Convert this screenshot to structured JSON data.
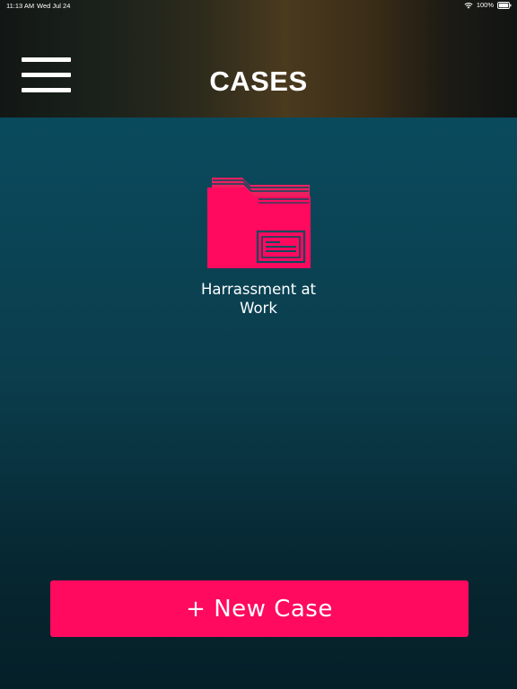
{
  "status_bar": {
    "time": "11:13 AM",
    "date": "Wed Jul 24",
    "battery": "100%",
    "wifi_icon": "wifi-icon",
    "battery_icon": "battery-icon"
  },
  "header": {
    "title": "CASES",
    "menu_icon": "hamburger-menu-icon"
  },
  "cases": [
    {
      "label": "Harrassment at Work",
      "icon": "folder-icon"
    }
  ],
  "actions": {
    "new_case_label": "+ New Case"
  },
  "colors": {
    "accent": "#ff0a5e",
    "background_top": "#07485c",
    "background_bottom": "#051f28",
    "header_brown": "#4a3a1e"
  }
}
